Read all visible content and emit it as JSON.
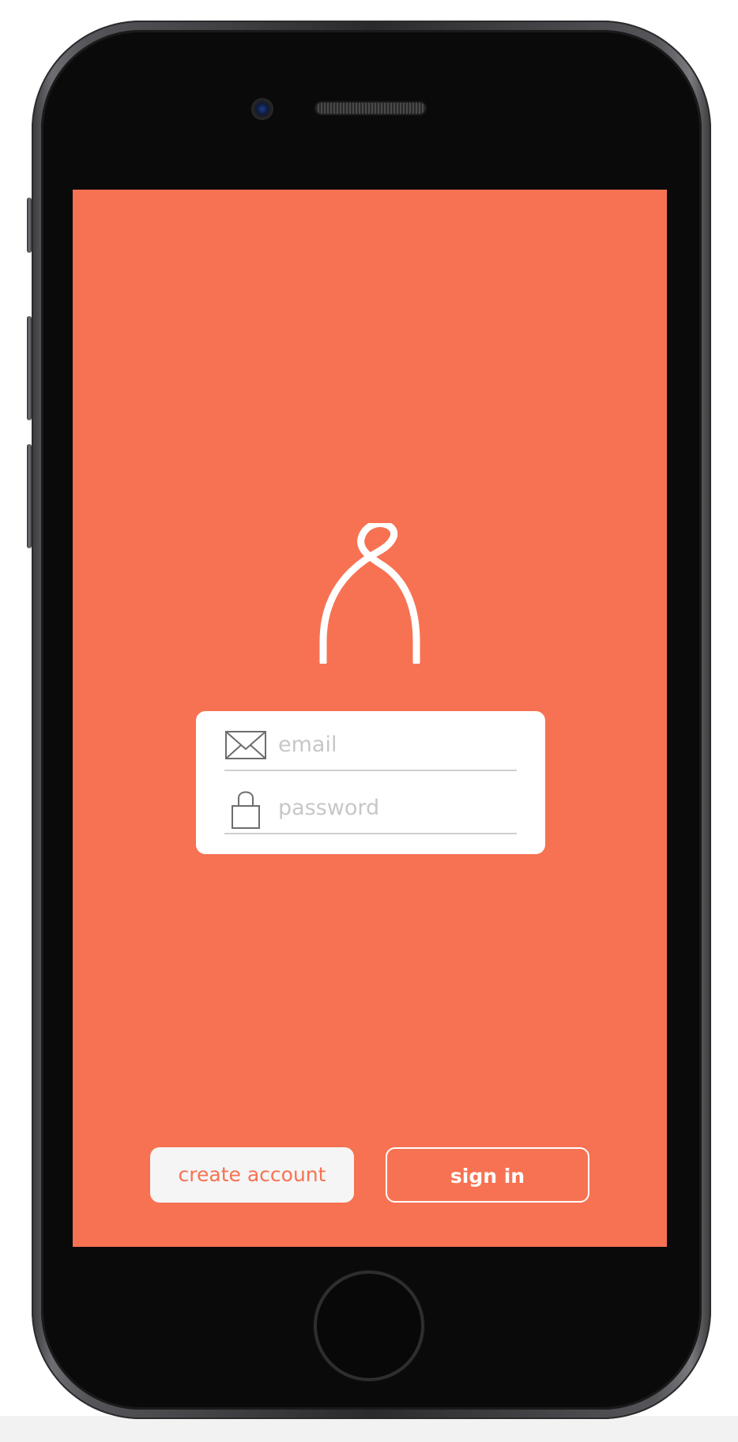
{
  "app": {
    "accent_color": "#f77252",
    "logo_icon": "person-knot-icon"
  },
  "login_form": {
    "email": {
      "icon": "envelope-icon",
      "placeholder": "email",
      "value": ""
    },
    "password": {
      "icon": "lock-icon",
      "placeholder": "password",
      "value": ""
    }
  },
  "actions": {
    "create_account_label": "create account",
    "sign_in_label": "sign in"
  }
}
